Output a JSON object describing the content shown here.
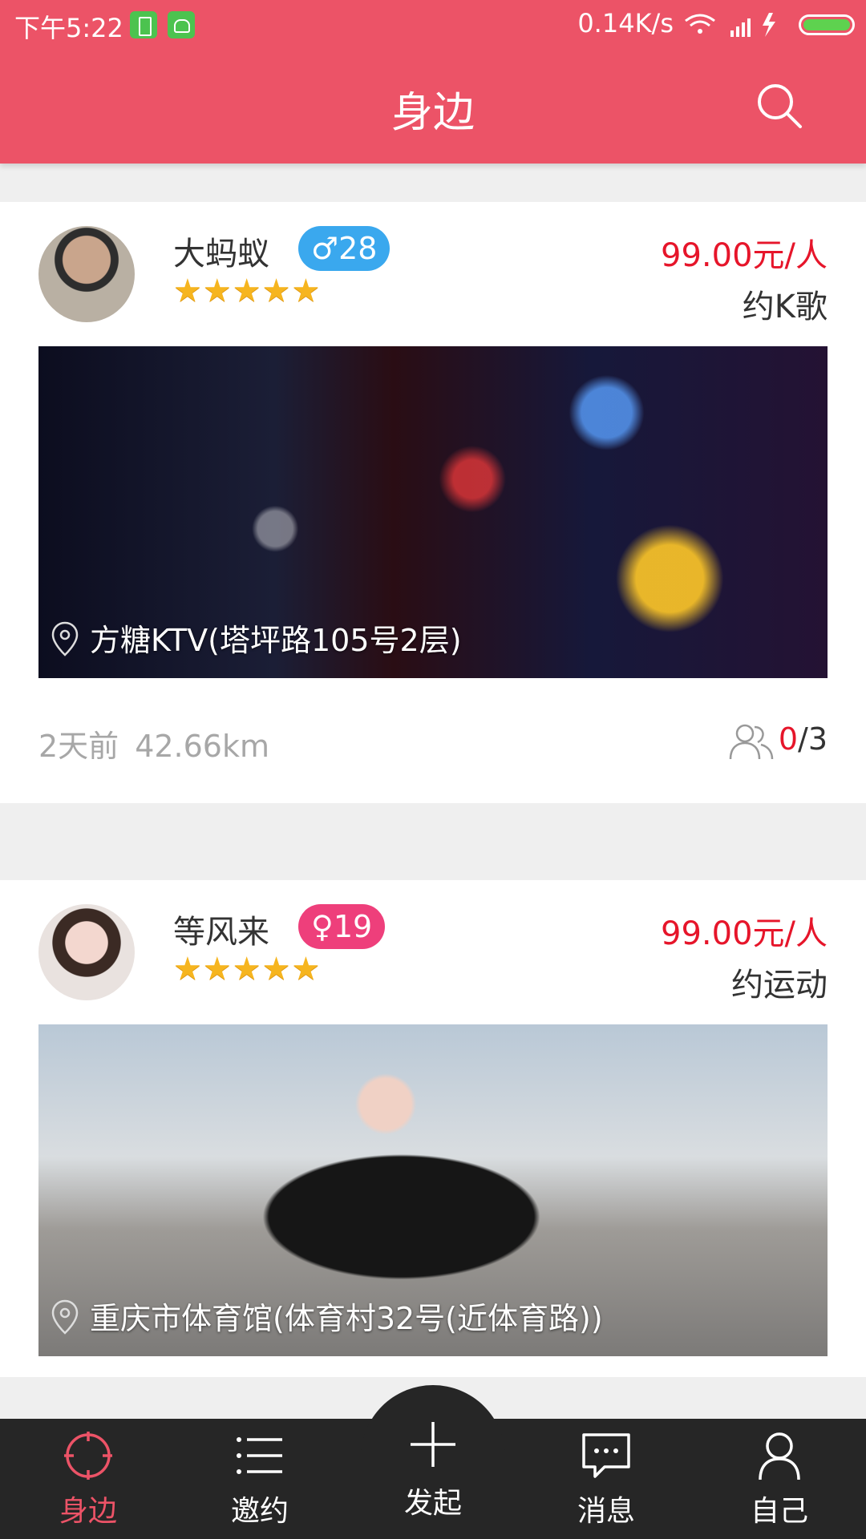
{
  "status_bar": {
    "time": "下午5:22",
    "network_speed": "0.14K/s"
  },
  "header": {
    "title": "身边",
    "search_icon": "search-icon"
  },
  "posts": [
    {
      "username": "大蚂蚁",
      "gender_age": "♂28",
      "rating": "★★★★★",
      "price": "99.00元/人",
      "activity": "约K歌",
      "location": "方糖KTV(塔坪路105号2层)",
      "posted": "2天前",
      "distance": "42.66km",
      "joined": "0",
      "capacity": "/3"
    },
    {
      "username": "等风来",
      "gender_age": "♀19",
      "rating": "★★★★★",
      "price": "99.00元/人",
      "activity": "约运动",
      "location": "重庆市体育馆(体育村32号(近体育路))"
    }
  ],
  "bottom_nav": {
    "items": [
      {
        "label": "身边",
        "icon": "target-icon",
        "active": true
      },
      {
        "label": "邀约",
        "icon": "list-icon"
      },
      {
        "label": "发起",
        "icon": "plus-icon"
      },
      {
        "label": "消息",
        "icon": "message-icon"
      },
      {
        "label": "自己",
        "icon": "user-icon"
      }
    ]
  },
  "colors": {
    "brand": "#ec5367",
    "price": "#e6152a",
    "male_badge": "#3aa8ee",
    "female_badge": "#ee3f7b",
    "nav_bg": "#262626"
  }
}
